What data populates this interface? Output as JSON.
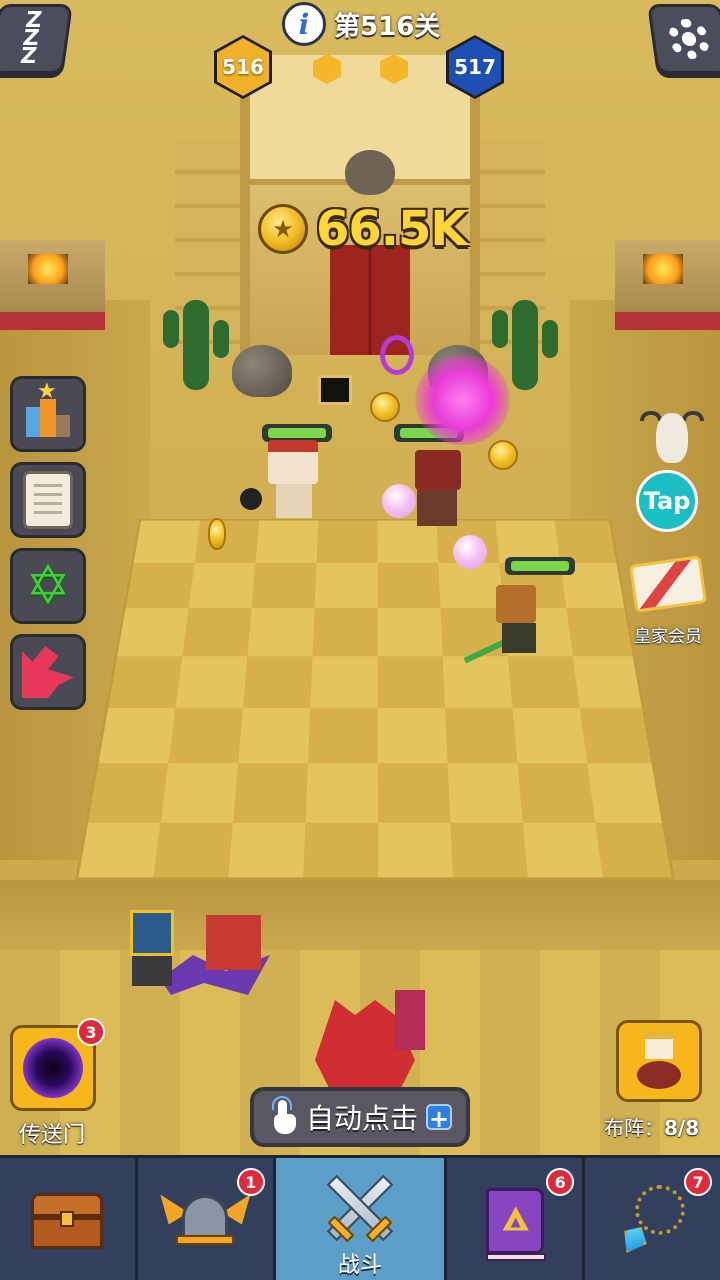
{
  "level": {
    "prefix": "第",
    "number": "516",
    "suffix": "关"
  },
  "stage_progress": {
    "current": "516",
    "next": "517"
  },
  "gold": "66.5K",
  "left_menu": [
    "trophy",
    "quest-scroll",
    "hexagram",
    "red-arrow"
  ],
  "right_menu": {
    "tap_label": "Tap",
    "royal_label": "皇家会员"
  },
  "portal": {
    "label": "传送门",
    "badge": "3"
  },
  "auto_click": {
    "label": "自动点击",
    "plus": "+"
  },
  "formation": {
    "label": "布阵：",
    "value": "8/8"
  },
  "navbar": [
    {
      "id": "chest",
      "badge": ""
    },
    {
      "id": "heroes",
      "badge": "1"
    },
    {
      "id": "battle",
      "label": "战斗",
      "active": true
    },
    {
      "id": "spellbook",
      "badge": "6"
    },
    {
      "id": "equipment",
      "badge": "7"
    }
  ],
  "colors": {
    "gold": "#ffd63a",
    "hex_current": "#f0b12a",
    "hex_next": "#1d4fb7",
    "navbar": "#2f3a52",
    "nav_active": "#5b9ec8",
    "badge": "#e02a3c"
  }
}
